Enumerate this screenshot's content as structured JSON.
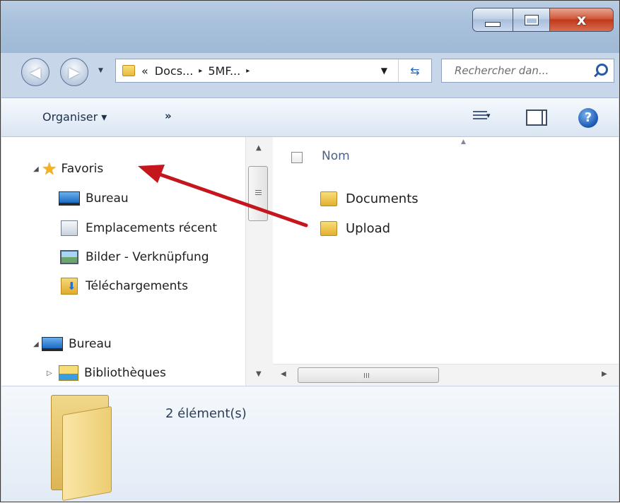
{
  "window": {
    "controls": {
      "minimize_icon": "minimize-icon",
      "maximize_icon": "maximize-icon",
      "close_glyph": "x"
    }
  },
  "navigation": {
    "breadcrumb_prefix": "«",
    "breadcrumbs": [
      "Docs...",
      "5MF..."
    ],
    "separator": "▸",
    "search_placeholder": "Rechercher dan..."
  },
  "toolbar": {
    "organize_label": "Organiser ▾",
    "more_label": "»",
    "view_arrow": "▾"
  },
  "nav_pane": {
    "favorites": {
      "label": "Favoris",
      "items": [
        {
          "label": "Bureau",
          "icon": "desktop-icon"
        },
        {
          "label": "Emplacements récent",
          "icon": "recent-places-icon"
        },
        {
          "label": "Bilder - Verknüpfung",
          "icon": "pictures-icon"
        },
        {
          "label": "Téléchargements",
          "icon": "downloads-icon"
        }
      ]
    },
    "desktop": {
      "label": "Bureau",
      "items": [
        {
          "label": "Bibliothèques",
          "icon": "libraries-icon"
        }
      ]
    }
  },
  "content": {
    "column_name": "Nom",
    "files": [
      {
        "label": "Documents",
        "icon": "folder-icon"
      },
      {
        "label": "Upload",
        "icon": "folder-icon"
      }
    ]
  },
  "details": {
    "item_count": "2 élément(s)"
  },
  "colors": {
    "annotation_arrow": "#c4161c",
    "window_frame": "#a9c1dc",
    "close_button": "#c0391b"
  }
}
